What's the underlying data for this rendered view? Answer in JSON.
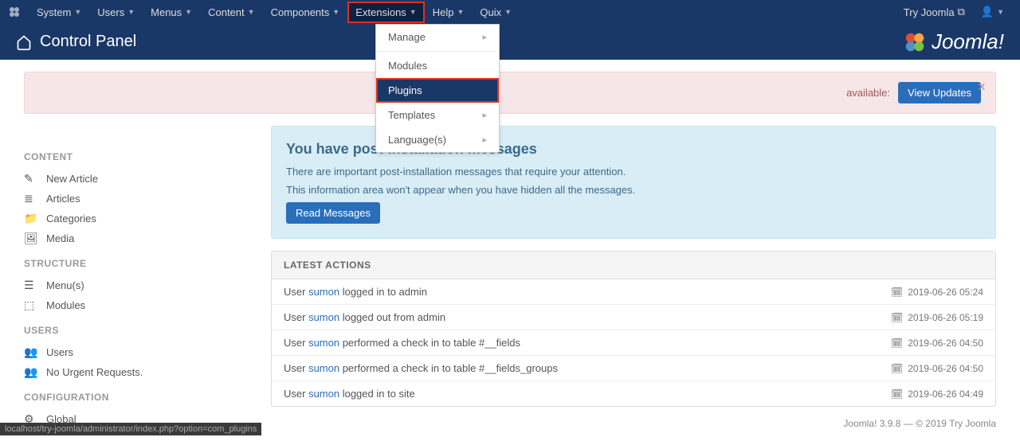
{
  "topnav": {
    "items": [
      {
        "label": "System"
      },
      {
        "label": "Users"
      },
      {
        "label": "Menus"
      },
      {
        "label": "Content"
      },
      {
        "label": "Components"
      },
      {
        "label": "Extensions",
        "active": true
      },
      {
        "label": "Help"
      },
      {
        "label": "Quix"
      }
    ],
    "right": {
      "try": "Try Joomla"
    }
  },
  "dropdown": {
    "items": [
      {
        "label": "Manage",
        "arrow": true
      },
      {
        "label": "Modules"
      },
      {
        "label": "Plugins",
        "highlighted": true
      },
      {
        "label": "Templates",
        "arrow": true
      },
      {
        "label": "Language(s)",
        "arrow": true
      }
    ]
  },
  "header": {
    "title": "Control Panel",
    "brand": "Joomla!"
  },
  "alert": {
    "text": "available:",
    "button": "View Updates"
  },
  "info": {
    "title": "You have post-installation messages",
    "line1": "There are important post-installation messages that require your attention.",
    "line2": "This information area won't appear when you have hidden all the messages.",
    "button": "Read Messages"
  },
  "sidebar": {
    "content": {
      "heading": "CONTENT",
      "newarticle": "New Article",
      "articles": "Articles",
      "categories": "Categories",
      "media": "Media"
    },
    "structure": {
      "heading": "STRUCTURE",
      "menus": "Menu(s)",
      "modules": "Modules"
    },
    "users": {
      "heading": "USERS",
      "users": "Users",
      "nourgent": "No Urgent Requests."
    },
    "config": {
      "heading": "CONFIGURATION",
      "global": "Global"
    }
  },
  "latest": {
    "heading": "LATEST ACTIONS",
    "rows": [
      {
        "prefix": "User ",
        "user": "sumon",
        "suffix": " logged in to admin",
        "ts": "2019-06-26 05:24"
      },
      {
        "prefix": "User ",
        "user": "sumon",
        "suffix": " logged out from admin",
        "ts": "2019-06-26 05:19"
      },
      {
        "prefix": "User ",
        "user": "sumon",
        "suffix": " performed a check in to table #__fields",
        "ts": "2019-06-26 04:50"
      },
      {
        "prefix": "User ",
        "user": "sumon",
        "suffix": " performed a check in to table #__fields_groups",
        "ts": "2019-06-26 04:50"
      },
      {
        "prefix": "User ",
        "user": "sumon",
        "suffix": " logged in to site",
        "ts": "2019-06-26 04:49"
      }
    ]
  },
  "statusbar": "localhost/try-joomla/administrator/index.php?option=com_plugins",
  "footer": "Joomla! 3.9.8 — © 2019 Try Joomla"
}
